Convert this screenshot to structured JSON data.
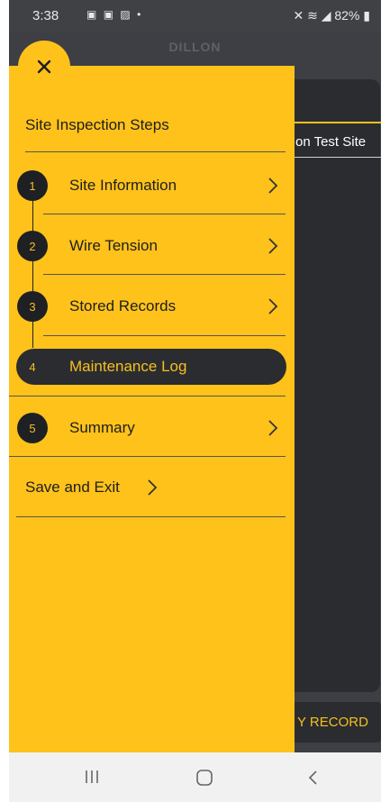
{
  "status_bar": {
    "time": "3:38",
    "notification_icons": [
      "message-icon",
      "message-icon",
      "image-icon",
      "dot-icon"
    ],
    "battery": "82%"
  },
  "app": {
    "brand": "DILLON"
  },
  "background": {
    "site_name_partial": "on Test Site",
    "record_button_partial": "Y RECORD"
  },
  "drawer": {
    "title": "Site Inspection Steps",
    "steps": [
      {
        "number": "1",
        "label": "Site Information",
        "active": false
      },
      {
        "number": "2",
        "label": "Wire Tension",
        "active": false
      },
      {
        "number": "3",
        "label": "Stored Records",
        "active": false
      },
      {
        "number": "4",
        "label": "Maintenance Log",
        "active": true
      },
      {
        "number": "5",
        "label": "Summary",
        "active": false
      }
    ],
    "save_exit_label": "Save and Exit"
  },
  "nav_bar": {
    "buttons": [
      "recent-apps-icon",
      "home-icon",
      "back-icon"
    ]
  },
  "colors": {
    "drawer_yellow": "#fec21b",
    "accent_yellow": "#f4c01e",
    "dark": "#2b2c30",
    "background": "#3d3f44"
  }
}
